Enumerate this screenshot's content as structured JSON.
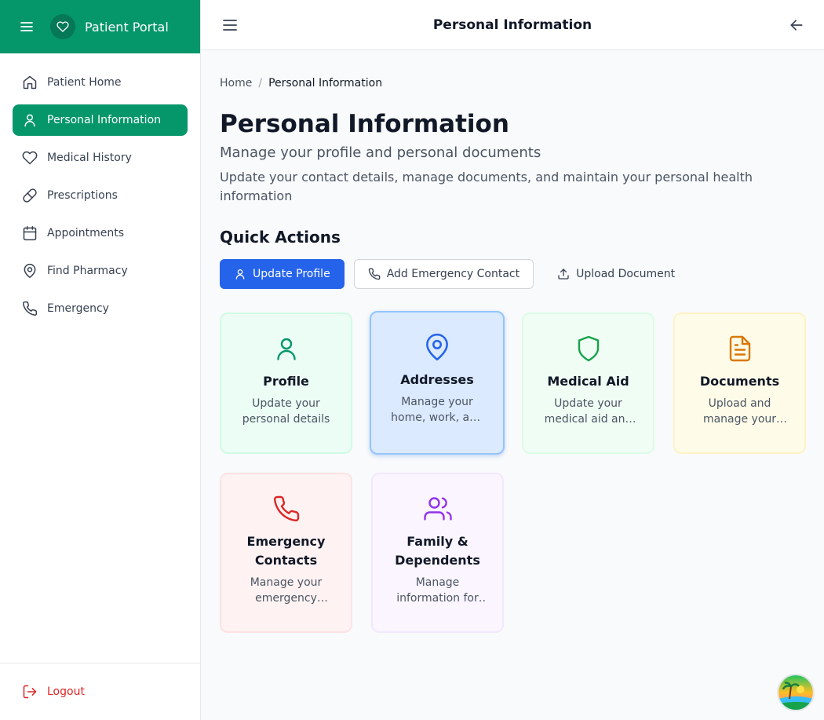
{
  "sidebar": {
    "brand_name": "Patient Portal",
    "items": [
      {
        "label": "Patient Home",
        "icon": "home-icon"
      },
      {
        "label": "Personal Information",
        "icon": "user-icon",
        "active": true
      },
      {
        "label": "Medical History",
        "icon": "heart-icon"
      },
      {
        "label": "Prescriptions",
        "icon": "pill-icon"
      },
      {
        "label": "Appointments",
        "icon": "calendar-icon"
      },
      {
        "label": "Find Pharmacy",
        "icon": "map-pin-icon"
      },
      {
        "label": "Emergency",
        "icon": "phone-icon"
      }
    ],
    "logout_label": "Logout"
  },
  "header": {
    "title": "Personal Information"
  },
  "breadcrumb": {
    "home": "Home",
    "separator": "/",
    "current": "Personal Information"
  },
  "main": {
    "title": "Personal Information",
    "subtitle": "Manage your profile and personal documents",
    "description": "Update your contact details, manage documents, and maintain your personal health information",
    "quick_actions_title": "Quick Actions"
  },
  "actions": {
    "update_profile": "Update Profile",
    "add_emergency_contact": "Add Emergency Contact",
    "upload_document": "Upload Document"
  },
  "cards": [
    {
      "title": "Profile",
      "description": "Update your personal details",
      "icon": "user-icon"
    },
    {
      "title": "Addresses",
      "description": "Manage your home, work, and other addresses",
      "icon": "map-pin-icon"
    },
    {
      "title": "Medical Aid",
      "description": "Update your medical aid and insurance details",
      "icon": "shield-icon"
    },
    {
      "title": "Documents",
      "description": "Upload and manage your documents",
      "icon": "file-text-icon"
    },
    {
      "title": "Emergency Contacts",
      "description": "Manage your emergency contacts",
      "icon": "phone-icon"
    },
    {
      "title": "Family & Dependents",
      "description": "Manage information for family members",
      "icon": "users-icon"
    }
  ],
  "colors": {
    "brand": "#059669",
    "primary": "#2563eb",
    "logout": "#dc2626",
    "profile": "#059669",
    "addresses": "#2563eb",
    "medical_aid": "#16a34a",
    "documents": "#d97706",
    "emergency": "#dc2626",
    "family": "#9333ea"
  }
}
